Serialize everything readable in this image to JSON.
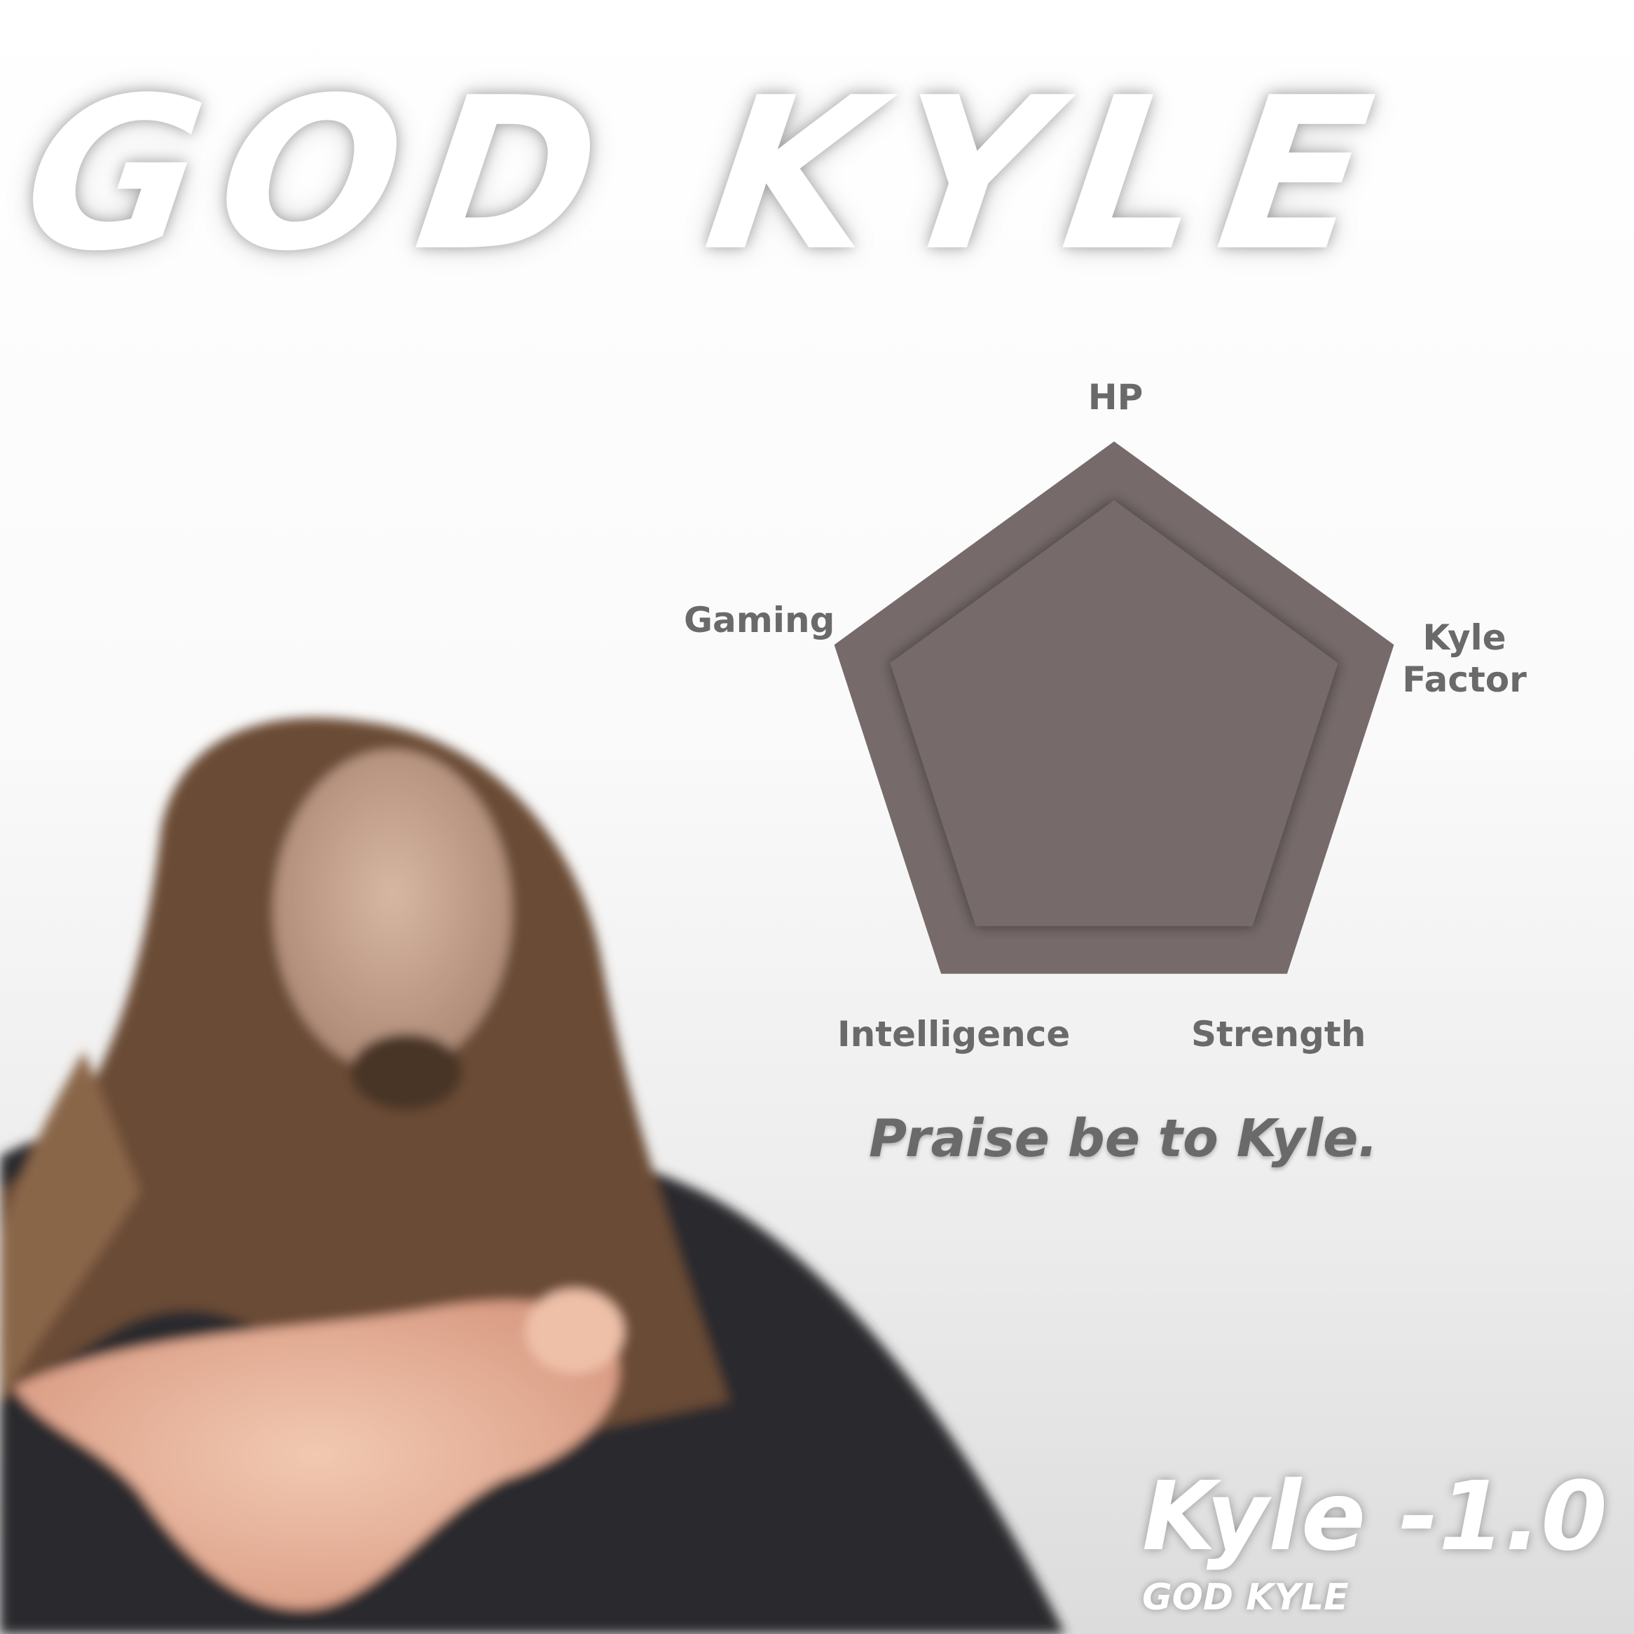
{
  "title": "GOD KYLE",
  "tagline": "Praise be to Kyle.",
  "version": "Kyle -1.0",
  "subtitle": "GOD KYLE",
  "colors": {
    "polygon_outer": "#766a6a",
    "polygon_inner": "#766a6a",
    "label": "#6a6a6a",
    "text_white": "#ffffff"
  },
  "chart_data": {
    "type": "radar",
    "axes": [
      "HP",
      "Kyle Factor",
      "Strength",
      "Intelligence",
      "Gaming"
    ],
    "series": [
      {
        "values": [
          1.0,
          1.0,
          1.0,
          1.0,
          1.0
        ]
      },
      {
        "values": [
          0.8,
          0.8,
          0.8,
          0.8,
          0.8
        ]
      }
    ],
    "range": [
      0,
      1
    ],
    "grid": false
  }
}
